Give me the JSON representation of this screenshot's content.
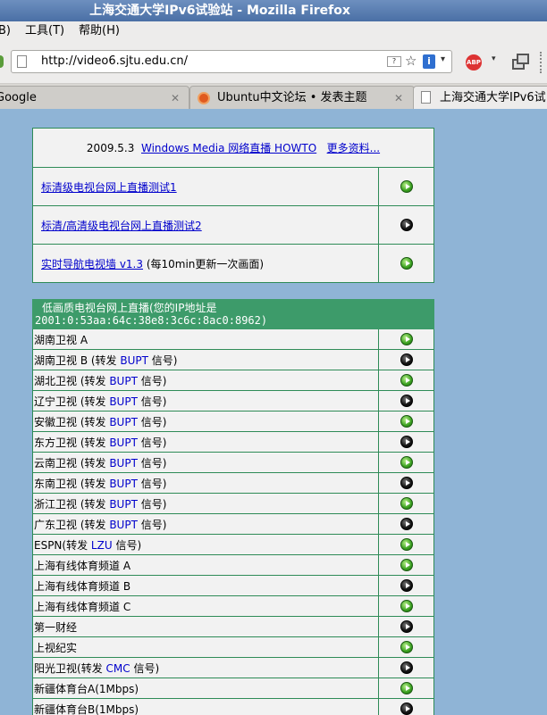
{
  "window": {
    "title": "上海交通大学IPv6试验站 - Mozilla Firefox"
  },
  "menu": {
    "items": [
      {
        "label": "B)"
      },
      {
        "label": "工具(T)"
      },
      {
        "label": "帮助(H)"
      }
    ]
  },
  "navbar": {
    "url": "http://video6.sjtu.edu.cn/",
    "abp_label": "ABP"
  },
  "tabs": [
    {
      "label": "Google"
    },
    {
      "label": "Ubuntu中文论坛 • 发表主题"
    },
    {
      "label": "上海交通大学IPv6试"
    }
  ],
  "top_box": {
    "date": "2009.5.3",
    "howto_link": "Windows Media 网络直播 HOWTO",
    "more_link": "更多资料...",
    "rows": [
      {
        "link": "标清级电视台网上直播测试1",
        "suffix": "",
        "icon": "green"
      },
      {
        "link": "标清/高清级电视台网上直播测试2",
        "suffix": "",
        "icon": "black"
      },
      {
        "link": "实时导航电视墙 v1.3",
        "suffix": " (每10min更新一次画面)",
        "icon": "green"
      }
    ]
  },
  "channel_box": {
    "header_line1": "低画质电视台网上直播(您的IP地址是",
    "header_line2": "2001:0:53aa:64c:38e8:3c6c:8ac0:8962)",
    "channels": [
      {
        "name": "湖南卫视 A",
        "pre": "",
        "src": "",
        "post": "",
        "icon": "green"
      },
      {
        "name": "湖南卫视 B",
        "pre": " (转发 ",
        "src": "BUPT",
        "post": " 信号)",
        "icon": "black"
      },
      {
        "name": "湖北卫视",
        "pre": " (转发 ",
        "src": "BUPT",
        "post": " 信号)",
        "icon": "green"
      },
      {
        "name": "辽宁卫视",
        "pre": " (转发 ",
        "src": "BUPT",
        "post": " 信号)",
        "icon": "black"
      },
      {
        "name": "安徽卫视",
        "pre": " (转发 ",
        "src": "BUPT",
        "post": " 信号)",
        "icon": "green"
      },
      {
        "name": "东方卫视",
        "pre": " (转发 ",
        "src": "BUPT",
        "post": " 信号)",
        "icon": "black"
      },
      {
        "name": "云南卫视",
        "pre": " (转发 ",
        "src": "BUPT",
        "post": " 信号)",
        "icon": "green"
      },
      {
        "name": "东南卫视",
        "pre": " (转发 ",
        "src": "BUPT",
        "post": " 信号)",
        "icon": "black"
      },
      {
        "name": "浙江卫视",
        "pre": " (转发 ",
        "src": "BUPT",
        "post": " 信号)",
        "icon": "green"
      },
      {
        "name": "广东卫视",
        "pre": " (转发 ",
        "src": "BUPT",
        "post": " 信号)",
        "icon": "black"
      },
      {
        "name": "ESPN",
        "pre": "(转发 ",
        "src": "LZU",
        "post": " 信号)",
        "icon": "green"
      },
      {
        "name": "上海有线体育频道 A",
        "pre": "",
        "src": "",
        "post": "",
        "icon": "green"
      },
      {
        "name": "上海有线体育频道 B",
        "pre": "",
        "src": "",
        "post": "",
        "icon": "black"
      },
      {
        "name": "上海有线体育频道 C",
        "pre": "",
        "src": "",
        "post": "",
        "icon": "green"
      },
      {
        "name": "第一财经",
        "pre": "",
        "src": "",
        "post": "",
        "icon": "black"
      },
      {
        "name": "上视纪实",
        "pre": "",
        "src": "",
        "post": "",
        "icon": "green"
      },
      {
        "name": "阳光卫视",
        "pre": "(转发 ",
        "src": "CMC",
        "post": " 信号)",
        "icon": "black"
      },
      {
        "name": "新疆体育台A(1Mbps)",
        "pre": "",
        "src": "",
        "post": "",
        "icon": "green"
      },
      {
        "name": "新疆体育台B(1Mbps)",
        "pre": "",
        "src": "",
        "post": "",
        "icon": "black"
      }
    ]
  },
  "colors": {
    "border": "#2e8b57",
    "header_bg": "#3d9b6a",
    "link": "#0000cc",
    "page_bg": "#8fb4d6"
  }
}
